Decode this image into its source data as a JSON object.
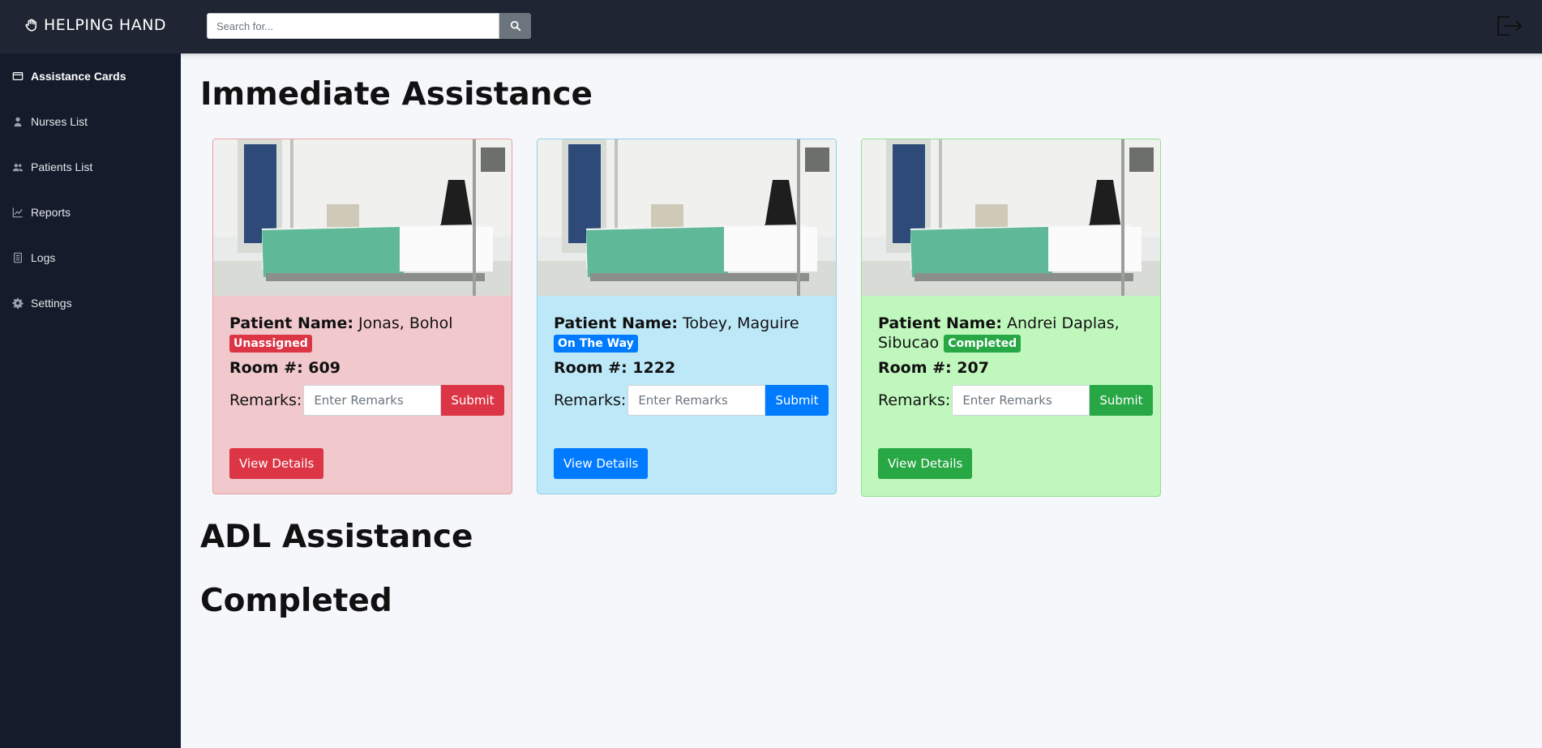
{
  "app": {
    "brand": "HELPING HAND"
  },
  "search": {
    "placeholder": "Search for..."
  },
  "sidebar": {
    "items": [
      {
        "label": "Assistance Cards",
        "icon": "card-icon",
        "active": true
      },
      {
        "label": "Nurses List",
        "icon": "nurse-icon"
      },
      {
        "label": "Patients List",
        "icon": "users-icon"
      },
      {
        "label": "Reports",
        "icon": "chart-icon"
      },
      {
        "label": "Logs",
        "icon": "log-icon"
      },
      {
        "label": "Settings",
        "icon": "gear-icon"
      }
    ]
  },
  "sections": {
    "immediate": "Immediate Assistance",
    "adl": "ADL Assistance",
    "completed": "Completed"
  },
  "labels": {
    "patient_name": "Patient Name:",
    "room": "Room #:",
    "remarks": "Remarks:",
    "remarks_placeholder": "Enter Remarks",
    "submit": "Submit",
    "view_details": "View Details"
  },
  "cards": [
    {
      "patient": "Jonas, Bohol",
      "status": "Unassigned",
      "room": "609",
      "color": "#dc3545"
    },
    {
      "patient": "Tobey, Maguire",
      "status": "On The Way",
      "room": "1222",
      "color": "#007bff"
    },
    {
      "patient": "Andrei Daplas, Sibucao",
      "status": "Completed",
      "room": "207",
      "color": "#28a745"
    }
  ]
}
